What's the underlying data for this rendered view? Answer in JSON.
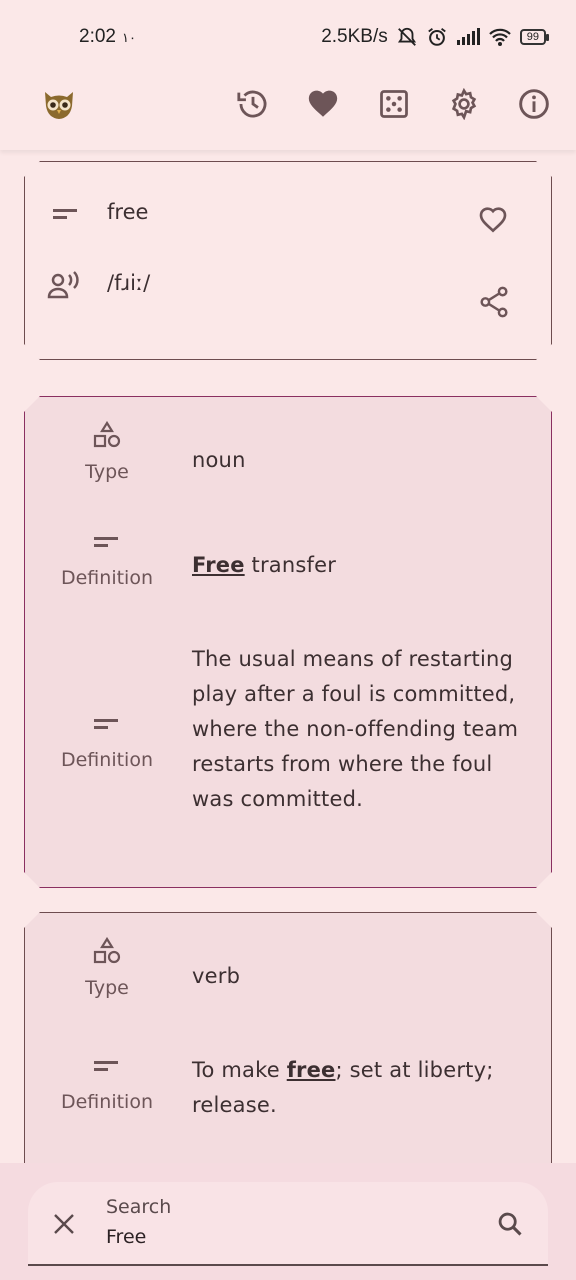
{
  "status": {
    "time": "2:02",
    "time_suffix": "١٠",
    "speed": "2.5KB/s",
    "battery": "99"
  },
  "word": {
    "text": "free",
    "pronunciation": "/fɹiː/"
  },
  "card1": {
    "type_label": "Type",
    "type_value": "noun",
    "def1_label": "Definition",
    "def1_bold": "Free",
    "def1_rest": " transfer",
    "def2_label": "Definition",
    "def2_value": "The usual means of restarting play after a foul is committed, where the non-offending team restarts from where the foul was committed."
  },
  "card2": {
    "type_label": "Type",
    "type_value": "verb",
    "def1_label": "Definition",
    "def1_pre": "To make ",
    "def1_bold": "free",
    "def1_rest": "; set at liberty; release."
  },
  "search": {
    "label": "Search",
    "value": "Free"
  },
  "colors": {
    "background": "#fbe8e8",
    "card_fill": "#f3dcdf",
    "accent_border": "#8a2f60",
    "icon": "#6d5558",
    "owl": "#8b6a2e"
  }
}
